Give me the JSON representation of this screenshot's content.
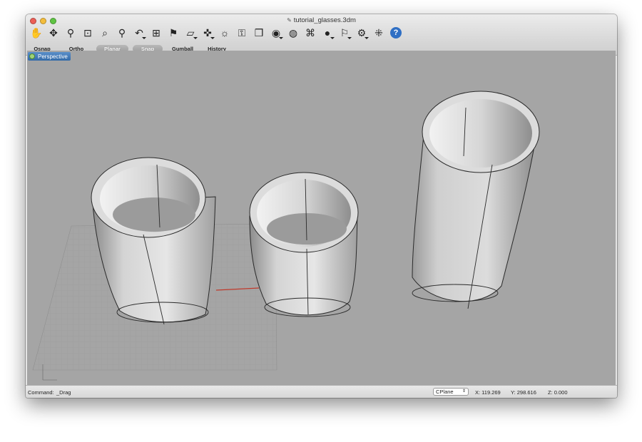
{
  "window": {
    "title": "tutorial_glasses.3dm"
  },
  "toolbar": {
    "icons": [
      {
        "name": "pan-hand-icon",
        "glyph": "✋"
      },
      {
        "name": "rotate-view-icon",
        "glyph": "✥"
      },
      {
        "name": "zoom-icon",
        "glyph": "⚲"
      },
      {
        "name": "zoom-window-icon",
        "glyph": "⊡"
      },
      {
        "name": "zoom-extents-icon",
        "glyph": "⌕"
      },
      {
        "name": "zoom-selected-icon",
        "glyph": "⚲"
      },
      {
        "name": "undo-view-icon",
        "glyph": "↶"
      },
      {
        "name": "four-viewports-icon",
        "glyph": "⊞"
      },
      {
        "name": "car-icon",
        "glyph": "⚑"
      },
      {
        "name": "cplane-icon",
        "glyph": "▱"
      },
      {
        "name": "gumball-tool-icon",
        "glyph": "✜"
      },
      {
        "name": "lightbulb-icon",
        "glyph": "☼"
      },
      {
        "name": "lock-icon",
        "glyph": "⚿"
      },
      {
        "name": "layer-book-icon",
        "glyph": "❒"
      },
      {
        "name": "color-wheel-icon",
        "glyph": "◉"
      },
      {
        "name": "shaded-sphere-icon",
        "glyph": "◍"
      },
      {
        "name": "render-teapot-icon",
        "glyph": "⌘"
      },
      {
        "name": "rendered-sphere-icon",
        "glyph": "●"
      },
      {
        "name": "flag-icon",
        "glyph": "⚐"
      },
      {
        "name": "settings-gear-icon",
        "glyph": "⚙"
      },
      {
        "name": "points-icon",
        "glyph": "⁜"
      },
      {
        "name": "help-icon",
        "glyph": "?"
      }
    ]
  },
  "status_buttons": [
    {
      "label": "Osnap",
      "active": false
    },
    {
      "label": "Ortho",
      "active": false
    },
    {
      "label": "Planar",
      "active": true
    },
    {
      "label": "Snap",
      "active": true
    },
    {
      "label": "Gumball",
      "active": false
    },
    {
      "label": "History",
      "active": false
    }
  ],
  "viewport": {
    "name": "Perspective"
  },
  "command": {
    "label": "Command:",
    "value": "_Drag"
  },
  "cplane": {
    "label": "CPlane"
  },
  "coords": {
    "x": "X: 119.269",
    "y": "Y: 298.616",
    "z": "Z: 0.000"
  }
}
